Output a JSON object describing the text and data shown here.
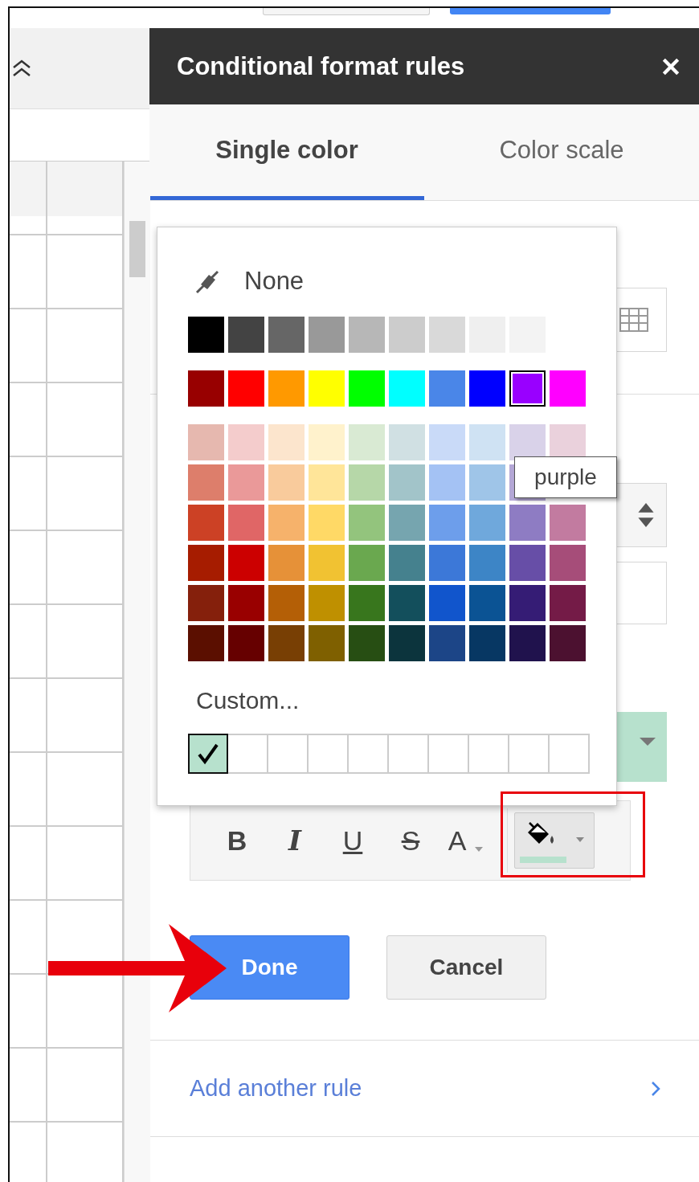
{
  "window": {
    "title": "Conditional format rules"
  },
  "tabs": [
    {
      "label": "Single color",
      "selected": true
    },
    {
      "label": "Color scale",
      "selected": false
    }
  ],
  "color_picker": {
    "none_label": "None",
    "palette_groups": [
      {
        "rows": [
          [
            {
              "color": "#000000",
              "selected": false
            },
            {
              "color": "#434343",
              "selected": false
            },
            {
              "color": "#666666",
              "selected": false
            },
            {
              "color": "#999999",
              "selected": false
            },
            {
              "color": "#b7b7b7",
              "selected": false
            },
            {
              "color": "#cccccc",
              "selected": false
            },
            {
              "color": "#d9d9d9",
              "selected": false
            },
            {
              "color": "#efefef",
              "selected": false
            },
            {
              "color": "#f3f3f3",
              "selected": false
            }
          ]
        ]
      },
      {
        "rows": [
          [
            {
              "color": "#980000",
              "selected": false
            },
            {
              "color": "#ff0000",
              "selected": false
            },
            {
              "color": "#ff9900",
              "selected": false
            },
            {
              "color": "#ffff00",
              "selected": false
            },
            {
              "color": "#00ff00",
              "selected": false
            },
            {
              "color": "#00ffff",
              "selected": false
            },
            {
              "color": "#4a86e8",
              "selected": false
            },
            {
              "color": "#0000ff",
              "selected": false
            },
            {
              "color": "#9900ff",
              "selected": true
            },
            {
              "color": "#ff00ff",
              "selected": false
            }
          ]
        ]
      },
      {
        "rows": [
          [
            {
              "color": "#e6b8af",
              "selected": false
            },
            {
              "color": "#f4cccc",
              "selected": false
            },
            {
              "color": "#fce5cd",
              "selected": false
            },
            {
              "color": "#fff2cc",
              "selected": false
            },
            {
              "color": "#d9ead3",
              "selected": false
            },
            {
              "color": "#d0e0e3",
              "selected": false
            },
            {
              "color": "#c9daf8",
              "selected": false
            },
            {
              "color": "#cfe2f3",
              "selected": false
            },
            {
              "color": "#d9d2e9",
              "selected": false
            },
            {
              "color": "#ead1dc",
              "selected": false
            }
          ],
          [
            {
              "color": "#dd7e6b",
              "selected": false
            },
            {
              "color": "#ea9999",
              "selected": false
            },
            {
              "color": "#f9cb9c",
              "selected": false
            },
            {
              "color": "#ffe599",
              "selected": false
            },
            {
              "color": "#b6d7a8",
              "selected": false
            },
            {
              "color": "#a2c4c9",
              "selected": false
            },
            {
              "color": "#a4c2f4",
              "selected": false
            },
            {
              "color": "#9fc5e8",
              "selected": false
            },
            {
              "color": "#b4a7d6",
              "selected": false
            }
          ],
          [
            {
              "color": "#cc4125",
              "selected": false
            },
            {
              "color": "#e06666",
              "selected": false
            },
            {
              "color": "#f6b26b",
              "selected": false
            },
            {
              "color": "#ffd966",
              "selected": false
            },
            {
              "color": "#93c47d",
              "selected": false
            },
            {
              "color": "#76a5af",
              "selected": false
            },
            {
              "color": "#6d9eeb",
              "selected": false
            },
            {
              "color": "#6fa8dc",
              "selected": false
            },
            {
              "color": "#8e7cc3",
              "selected": false
            },
            {
              "color": "#c27ba0",
              "selected": false
            }
          ],
          [
            {
              "color": "#a61c00",
              "selected": false
            },
            {
              "color": "#cc0000",
              "selected": false
            },
            {
              "color": "#e69138",
              "selected": false
            },
            {
              "color": "#f1c232",
              "selected": false
            },
            {
              "color": "#6aa84f",
              "selected": false
            },
            {
              "color": "#45818e",
              "selected": false
            },
            {
              "color": "#3c78d8",
              "selected": false
            },
            {
              "color": "#3d85c6",
              "selected": false
            },
            {
              "color": "#674ea7",
              "selected": false
            },
            {
              "color": "#a64d79",
              "selected": false
            }
          ],
          [
            {
              "color": "#85200c",
              "selected": false
            },
            {
              "color": "#990000",
              "selected": false
            },
            {
              "color": "#b45f06",
              "selected": false
            },
            {
              "color": "#bf9000",
              "selected": false
            },
            {
              "color": "#38761d",
              "selected": false
            },
            {
              "color": "#134f5c",
              "selected": false
            },
            {
              "color": "#1155cc",
              "selected": false
            },
            {
              "color": "#0b5394",
              "selected": false
            },
            {
              "color": "#351c75",
              "selected": false
            },
            {
              "color": "#741b47",
              "selected": false
            }
          ],
          [
            {
              "color": "#5b0f00",
              "selected": false
            },
            {
              "color": "#660000",
              "selected": false
            },
            {
              "color": "#783f04",
              "selected": false
            },
            {
              "color": "#7f6000",
              "selected": false
            },
            {
              "color": "#274e13",
              "selected": false
            },
            {
              "color": "#0c343d",
              "selected": false
            },
            {
              "color": "#1c4587",
              "selected": false
            },
            {
              "color": "#073763",
              "selected": false
            },
            {
              "color": "#20124d",
              "selected": false
            },
            {
              "color": "#4c1130",
              "selected": false
            }
          ]
        ]
      }
    ],
    "custom_label": "Custom...",
    "custom_swatches": [
      {
        "color": "#b7e1cd",
        "checked": true
      },
      {
        "checked": false
      },
      {
        "checked": false
      },
      {
        "checked": false
      },
      {
        "checked": false
      },
      {
        "checked": false
      },
      {
        "checked": false
      },
      {
        "checked": false
      },
      {
        "checked": false
      },
      {
        "checked": false
      }
    ],
    "tooltip": "purple"
  },
  "style_buttons": [
    {
      "label": "B",
      "kind": "bold"
    },
    {
      "label": "I",
      "kind": "italic"
    },
    {
      "label": "U",
      "kind": "underline"
    },
    {
      "label": "S",
      "kind": "strike"
    },
    {
      "label": "A",
      "kind": "color"
    }
  ],
  "buttons": [
    {
      "label": "Done",
      "kind": "primary"
    },
    {
      "label": "Cancel",
      "kind": "secondary"
    }
  ],
  "add_rule_link": "Add another rule"
}
